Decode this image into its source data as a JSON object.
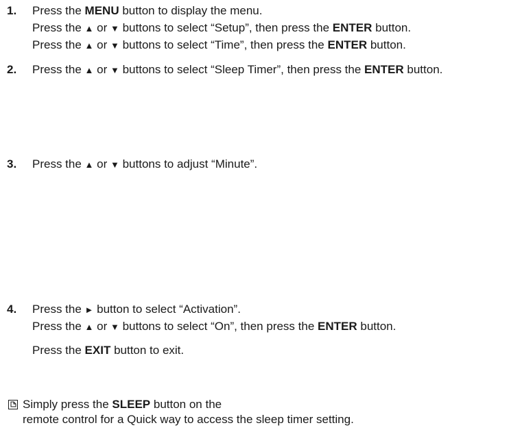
{
  "steps": [
    {
      "number": "1.",
      "line1": {
        "a": "Press the ",
        "b": "MENU",
        "c": " button to display the menu."
      },
      "line2": {
        "a": "Press the ",
        "up": "▲",
        "or": " or ",
        "down": "▼",
        "c": " buttons to select “Setup”, then press the ",
        "b": "ENTER",
        "d": " button."
      },
      "line3": {
        "a": "Press the ",
        "up": "▲",
        "or": " or ",
        "down": "▼",
        "c": " buttons to select “Time”, then press the ",
        "b": "ENTER",
        "d": " button."
      }
    },
    {
      "number": "2.",
      "line1": {
        "a": "Press the ",
        "up": "▲",
        "or": " or ",
        "down": "▼",
        "c": " buttons to select “Sleep Timer”, then press the ",
        "b": "ENTER",
        "d": " button."
      }
    },
    {
      "number": "3.",
      "line1": {
        "a": "Press the ",
        "up": "▲",
        "or": " or ",
        "down": "▼",
        "c": " buttons to adjust “Minute”."
      }
    },
    {
      "number": "4.",
      "line1": {
        "a": "Press the ",
        "right": "►",
        "c": " button to select “Activation”."
      },
      "line2": {
        "a": "Press the ",
        "up": "▲",
        "or": " or ",
        "down": "▼",
        "c": " buttons to select “On”, then press the ",
        "b": "ENTER",
        "d": " button."
      },
      "line3": {
        "a": "Press the ",
        "b": "EXIT",
        "c": " button to exit."
      }
    }
  ],
  "note": {
    "icon": "note-icon",
    "line1": {
      "a": "Simply press the ",
      "b": "SLEEP",
      "c": " button on the"
    },
    "line2": "remote control for a Quick way to access the sleep timer setting."
  }
}
